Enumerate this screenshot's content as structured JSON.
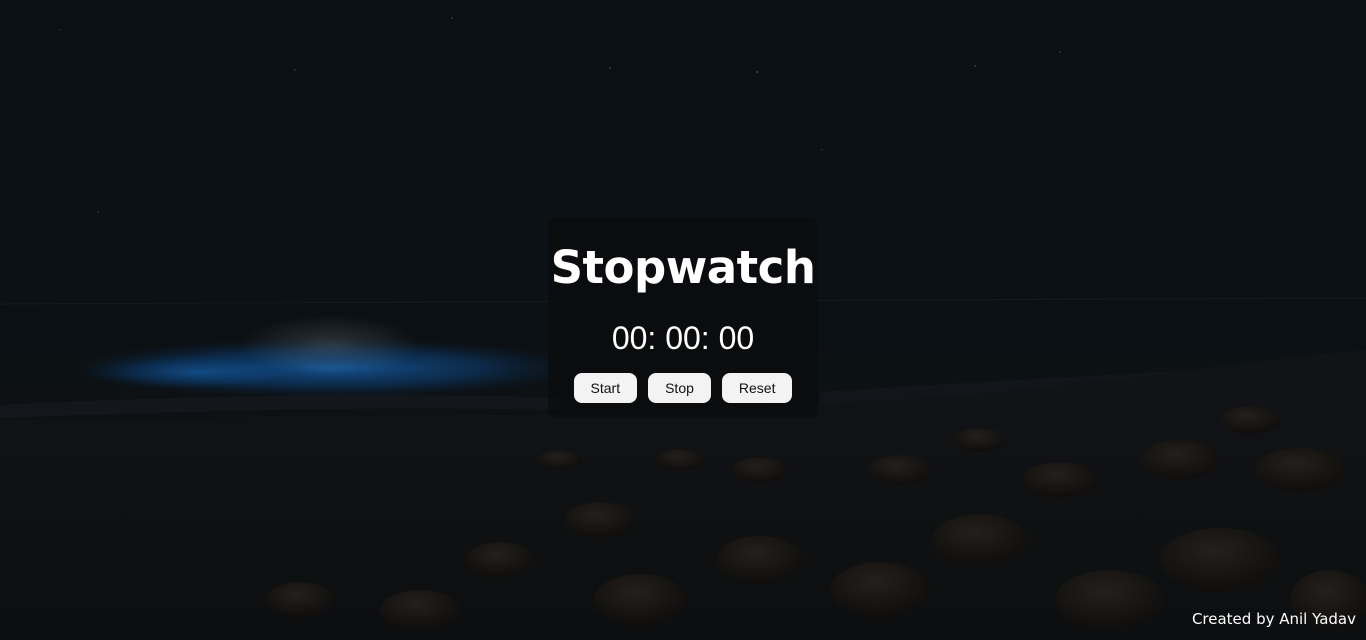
{
  "app": {
    "title": "Stopwatch",
    "time": "00: 00: 00"
  },
  "controls": {
    "start_label": "Start",
    "stop_label": "Stop",
    "reset_label": "Reset"
  },
  "footer": {
    "credit": "Created by Anil Yadav"
  },
  "colors": {
    "card_background": "#0a0b0c",
    "button_background": "#f3f3f3",
    "text": "#ffffff",
    "wave_glow": "#1a6cc0"
  }
}
